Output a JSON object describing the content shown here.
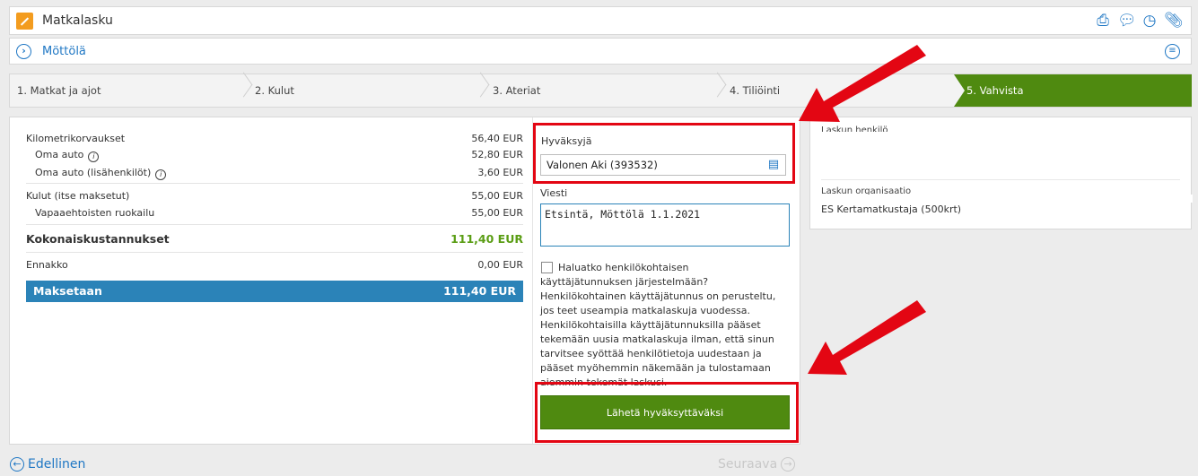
{
  "header": {
    "title": "Matkalasku"
  },
  "subheader": {
    "name": "Möttölä"
  },
  "steps": [
    "1. Matkat ja ajot",
    "2. Kulut",
    "3. Ateriat",
    "4. Tiliöinti",
    "5. Vahvista"
  ],
  "summary": {
    "km": {
      "label": "Kilometrikorvaukset",
      "value": "56,40 EUR"
    },
    "own_car": {
      "label": "Oma auto",
      "value": "52,80 EUR"
    },
    "own_car_extra": {
      "label": "Oma auto (lisähenkilöt)",
      "value": "3,60 EUR"
    },
    "expenses": {
      "label": "Kulut (itse maksetut)",
      "value": "55,00 EUR"
    },
    "volunteer_meal": {
      "label": "Vapaaehtoisten ruokailu",
      "value": "55,00 EUR"
    },
    "total": {
      "label": "Kokonaiskustannukset",
      "value": "111,40 EUR"
    },
    "advance": {
      "label": "Ennakko",
      "value": "0,00 EUR"
    },
    "pay": {
      "label": "Maksetaan",
      "value": "111,40 EUR"
    }
  },
  "form": {
    "approver_label": "Hyväksyjä",
    "approver_value": "Valonen Aki (393532)",
    "message_label": "Viesti",
    "message_value": "Etsintä, Möttölä 1.1.2021",
    "checkbox_text": "Haluatko henkilökohtaisen käyttäjätunnuksen järjestelmään? Henkilökohtainen käyttäjätunnus on perusteltu, jos teet useampia matkalaskuja vuodessa. Henkilökohtaisilla käyttäjätunnuksilla pääset tekemään uusia matkalaskuja ilman, että sinun tarvitsee syöttää henkilötietoja uudestaan ja pääset myöhemmin näkemään ja tulostamaan aiemmin tekemät laskusi.",
    "send_label": "Lähetä hyväksyttäväksi"
  },
  "right_panel": {
    "person_label": "Laskun henkilö",
    "org_label": "Laskun organisaatio",
    "org_value": "ES Kertamatkustaja (500krt)"
  },
  "footer": {
    "prev": "Edellinen",
    "next": "Seuraava"
  },
  "colors": {
    "accent": "#1f77c4",
    "green": "#4f8a10",
    "pay_bar": "#2b83b8",
    "highlight": "#e30613"
  }
}
